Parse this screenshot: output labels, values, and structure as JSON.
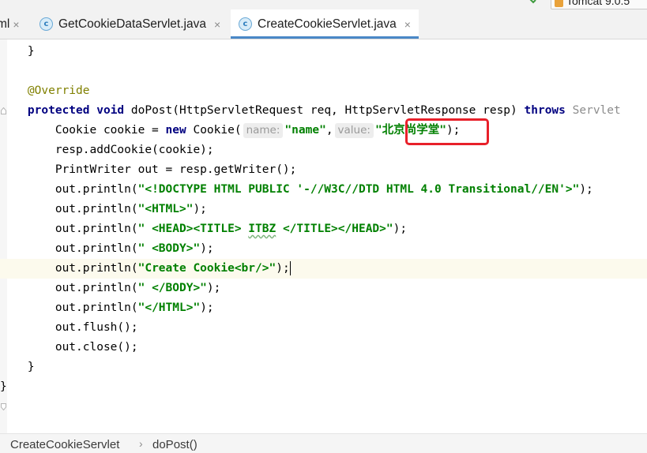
{
  "toolbar": {
    "run_config_label": "Tomcat 9.0.5"
  },
  "tabs": [
    {
      "label": "ml",
      "icon": "html-file-icon",
      "active": false
    },
    {
      "label": "GetCookieDataServlet.java",
      "icon": "java-class-icon",
      "active": false
    },
    {
      "label": "CreateCookieServlet.java",
      "icon": "java-class-icon",
      "active": true
    }
  ],
  "tab_icon_letter": "c",
  "close_glyph": "×",
  "editor": {
    "code": {
      "l1": "}",
      "l3": "@Override",
      "l4_kw1": "protected",
      "l4_kw2": "void",
      "l4_text": "doPost(HttpServletRequest req, HttpServletResponse resp)",
      "l4_kw3": "throws",
      "l4_tail": "Servlet",
      "l5_a": "Cookie cookie = ",
      "l5_kw": "new",
      "l5_b": "Cookie(",
      "l5_hint1": "name:",
      "l5_str1": "\"name\"",
      "l5_comma": ",",
      "l5_hint2": "value:",
      "l5_str2": "\"北京尚学堂\"",
      "l5_end": ");",
      "l6": "resp.addCookie(cookie);",
      "l7": "PrintWriter out = resp.getWriter();",
      "l8_a": "out.println(",
      "l8_str": "\"<!DOCTYPE HTML PUBLIC '-//W3C//DTD HTML 4.0 Transitional//EN'>\"",
      "l8_end": ");",
      "l9_a": "out.println(",
      "l9_str": "\"<HTML>\"",
      "l9_end": ");",
      "l10_a": "out.println(",
      "l10_str1": "\" <HEAD><TITLE> ",
      "l10_sq": "ITBZ",
      "l10_str2": " </TITLE></HEAD>\"",
      "l10_end": ");",
      "l11_a": "out.println(",
      "l11_str": "\" <BODY>\"",
      "l11_end": ");",
      "l12_a": "out.println(",
      "l12_str": "\"Create Cookie<br/>\"",
      "l12_end": ");",
      "l13_a": "out.println(",
      "l13_str": "\" </BODY>\"",
      "l13_end": ");",
      "l14_a": "out.println(",
      "l14_str": "\"</HTML>\"",
      "l14_end": ");",
      "l15": "out.flush();",
      "l16": "out.close();",
      "l17": "}",
      "l18": "}"
    }
  },
  "breadcrumb": {
    "class_name": "CreateCookieServlet",
    "separator": "›",
    "method_name": "doPost()"
  },
  "colors": {
    "keyword": "#000080",
    "annotation": "#808000",
    "string": "#008000",
    "highlight_box": "#e8202a",
    "active_tab_underline": "#4a88c7"
  }
}
